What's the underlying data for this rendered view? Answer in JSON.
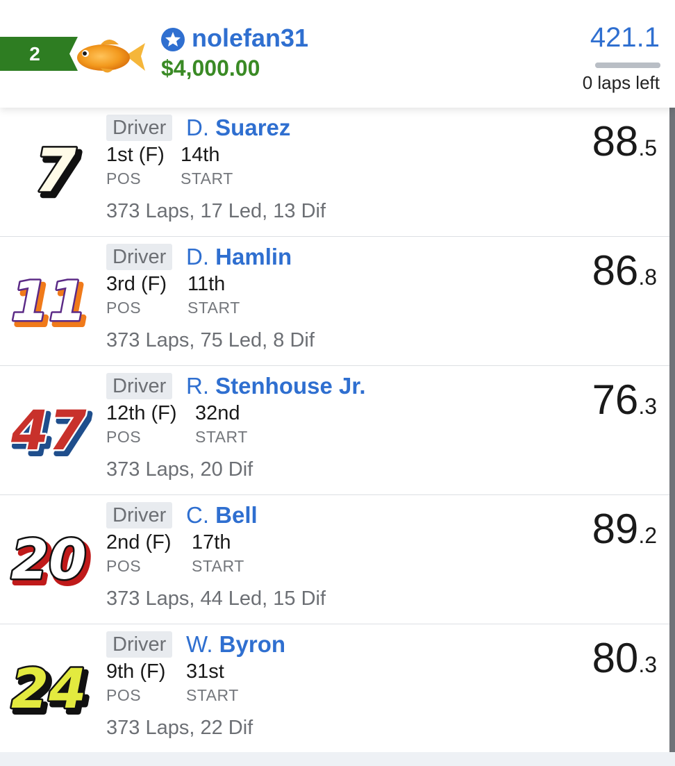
{
  "header": {
    "rank": "2",
    "avatar_icon": "goldfish",
    "user_icon": "star-badge-icon",
    "username": "nolefan31",
    "balance": "$4,000.00",
    "total_points": "421.1",
    "laps_left": "0 laps left",
    "progress_fraction": 1.0
  },
  "colors": {
    "brand_blue": "#2f6fd0",
    "money_green": "#3a8a25",
    "rank_green": "#2e7d22"
  },
  "drivers": [
    {
      "tag": "Driver",
      "first": "D.",
      "last": "Suarez",
      "car": "7",
      "pos": "1st (F)",
      "start": "14th",
      "pos_label": "POS",
      "start_label": "START",
      "stats": "373 Laps, 17 Led, 13 Dif",
      "score_int": "88",
      "score_dec": ".5"
    },
    {
      "tag": "Driver",
      "first": "D.",
      "last": "Hamlin",
      "car": "11",
      "pos": "3rd (F)",
      "start": "11th",
      "pos_label": "POS",
      "start_label": "START",
      "stats": "373 Laps, 75 Led, 8 Dif",
      "score_int": "86",
      "score_dec": ".8"
    },
    {
      "tag": "Driver",
      "first": "R.",
      "last": "Stenhouse Jr.",
      "car": "47",
      "pos": "12th (F)",
      "start": "32nd",
      "pos_label": "POS",
      "start_label": "START",
      "stats": "373 Laps, 20 Dif",
      "score_int": "76",
      "score_dec": ".3"
    },
    {
      "tag": "Driver",
      "first": "C.",
      "last": "Bell",
      "car": "20",
      "pos": "2nd (F)",
      "start": "17th",
      "pos_label": "POS",
      "start_label": "START",
      "stats": "373 Laps, 44 Led, 15 Dif",
      "score_int": "89",
      "score_dec": ".2"
    },
    {
      "tag": "Driver",
      "first": "W.",
      "last": "Byron",
      "car": "24",
      "pos": "9th (F)",
      "start": "31st",
      "pos_label": "POS",
      "start_label": "START",
      "stats": "373 Laps, 22 Dif",
      "score_int": "80",
      "score_dec": ".3"
    }
  ]
}
